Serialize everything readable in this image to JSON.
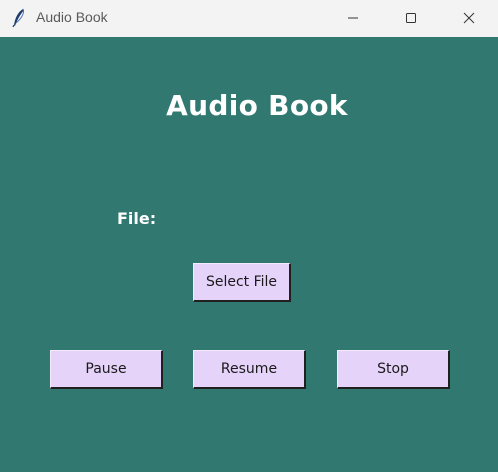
{
  "window": {
    "title": "Audio Book",
    "icon": "feather-icon",
    "controls": [
      "minimize-icon",
      "maximize-icon",
      "close-icon"
    ]
  },
  "main": {
    "heading": "Audio Book",
    "file_label": "File:",
    "select_file_label": "Select File",
    "pause_label": "Pause",
    "resume_label": "Resume",
    "stop_label": "Stop"
  },
  "colors": {
    "background": "#307870",
    "button": "#e6d3fa",
    "text_light": "#ffffff"
  }
}
